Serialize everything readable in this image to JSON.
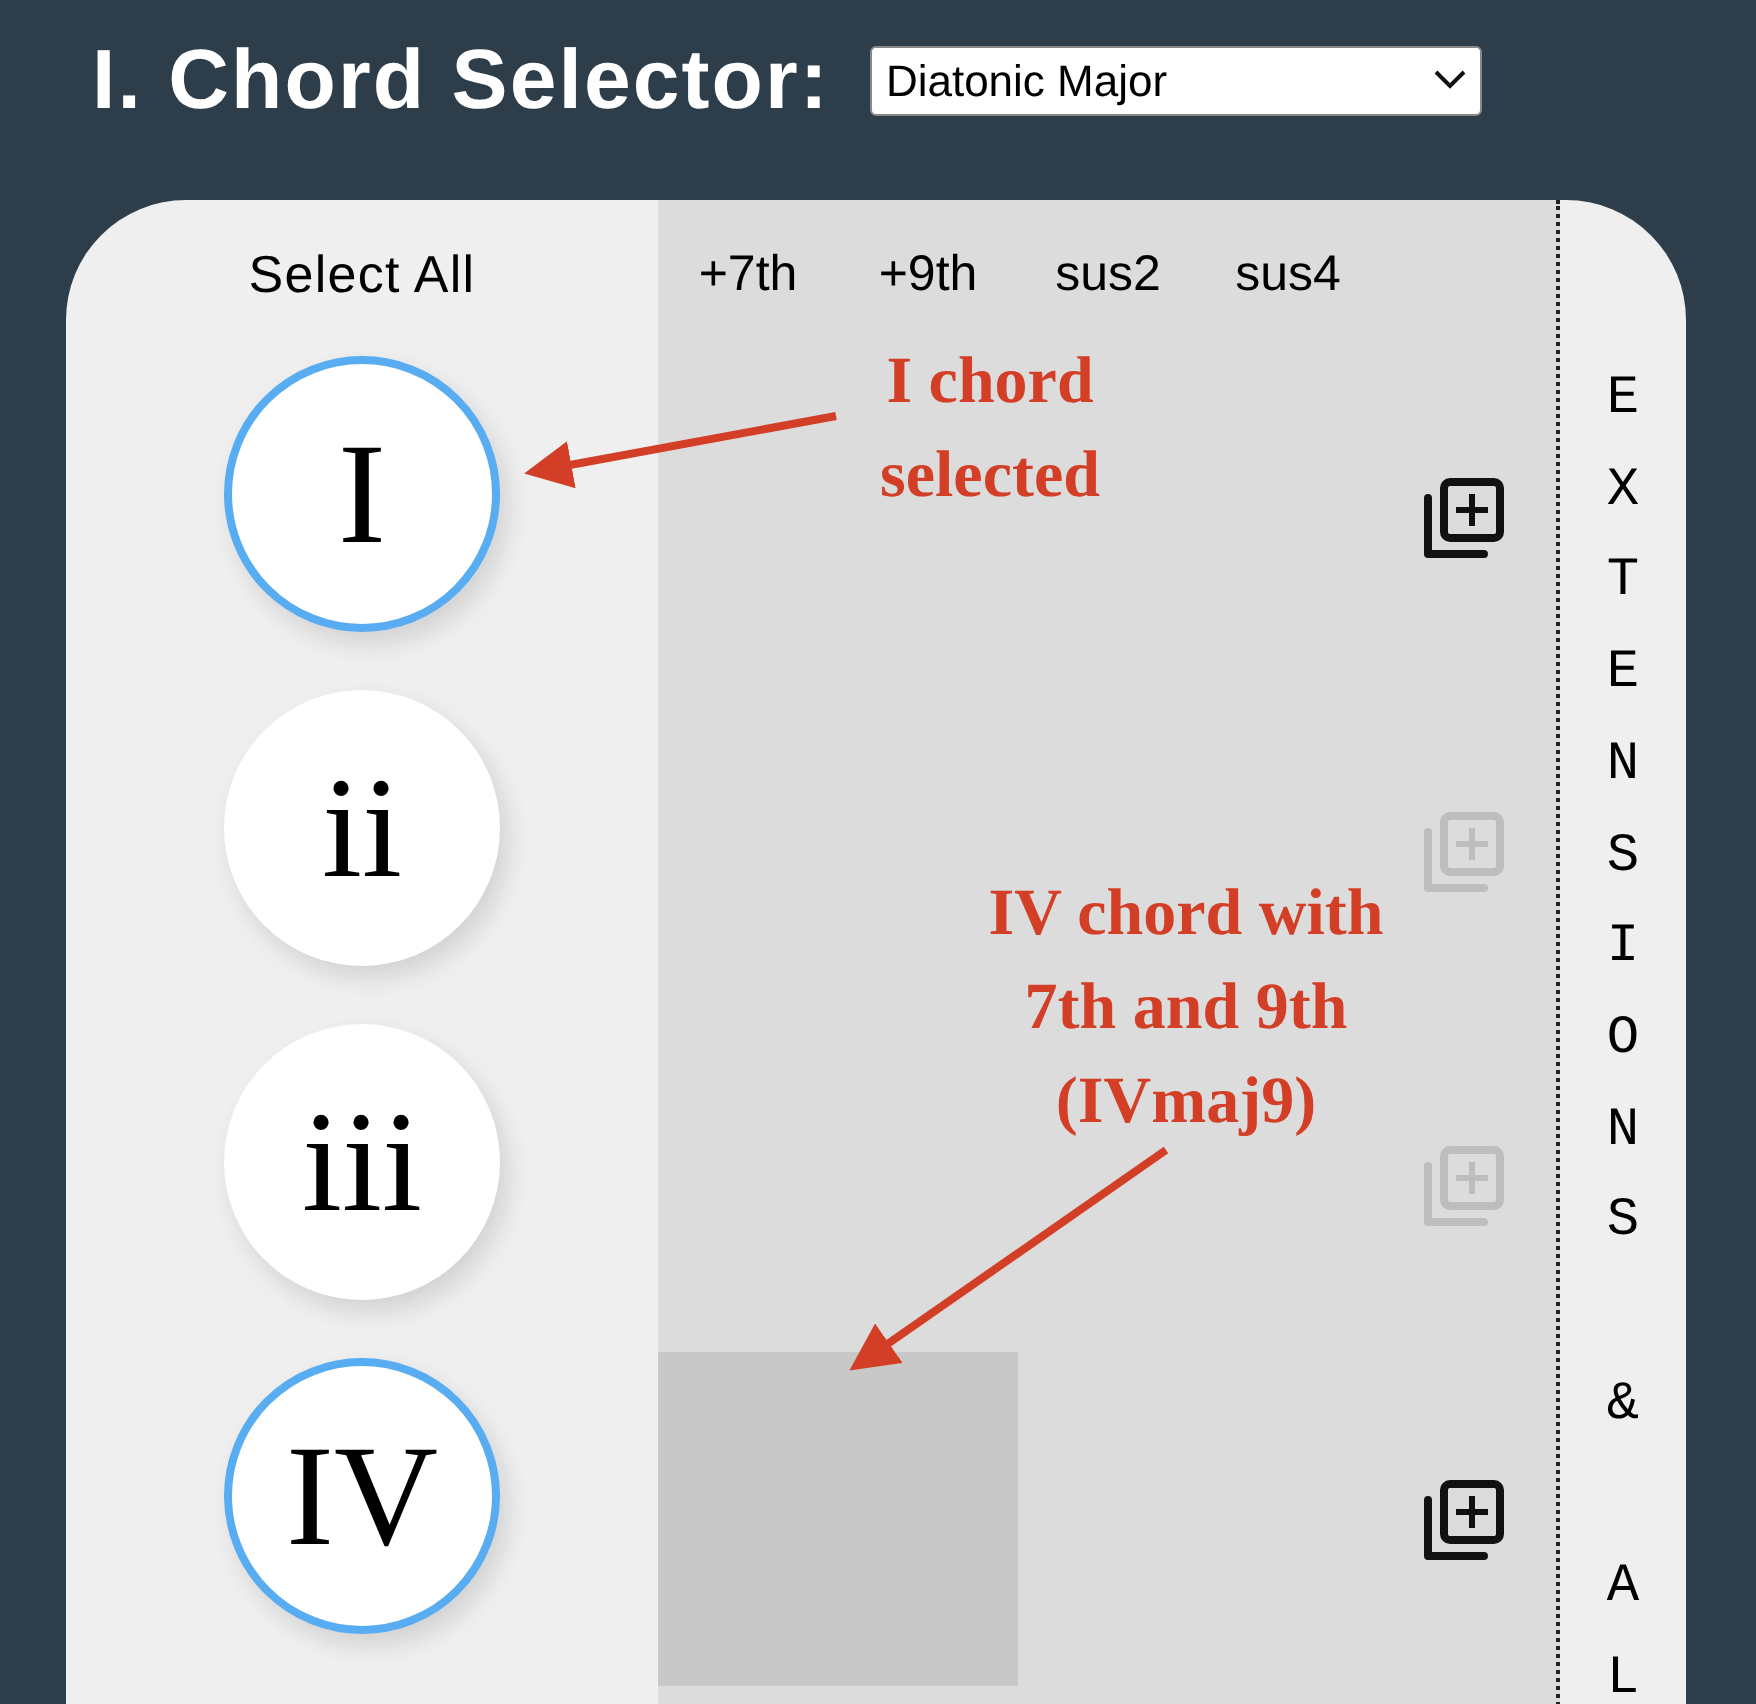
{
  "title": "I. Chord Selector:",
  "scale_select": {
    "value": "Diatonic Major"
  },
  "select_all": "Select All",
  "extension_columns": [
    "+7th",
    "+9th",
    "sus2",
    "sus4"
  ],
  "chords": [
    {
      "numeral": "I",
      "selected": true,
      "extensions": [
        {
          "selected": false
        },
        {
          "selected": false
        },
        {
          "selected": false
        },
        {
          "selected": false
        }
      ]
    },
    {
      "numeral": "ii",
      "selected": false,
      "extensions": [
        {
          "selected": false
        },
        {
          "selected": false
        },
        {
          "selected": false
        },
        {
          "selected": false
        }
      ]
    },
    {
      "numeral": "iii",
      "selected": false,
      "extensions": [
        {
          "selected": false
        },
        {
          "selected": false
        },
        {
          "selected": false
        },
        {
          "selected": false
        }
      ]
    },
    {
      "numeral": "IV",
      "selected": true,
      "extensions": [
        {
          "selected": true
        },
        {
          "selected": true
        },
        {
          "selected": false
        },
        {
          "selected": false
        }
      ]
    }
  ],
  "side_label": "EXTENSIONS & AL",
  "annotations": [
    {
      "lines": [
        "I chord",
        "selected"
      ]
    },
    {
      "lines": [
        "IV chord with",
        "7th and 9th",
        "(IVmaj9)"
      ]
    }
  ]
}
